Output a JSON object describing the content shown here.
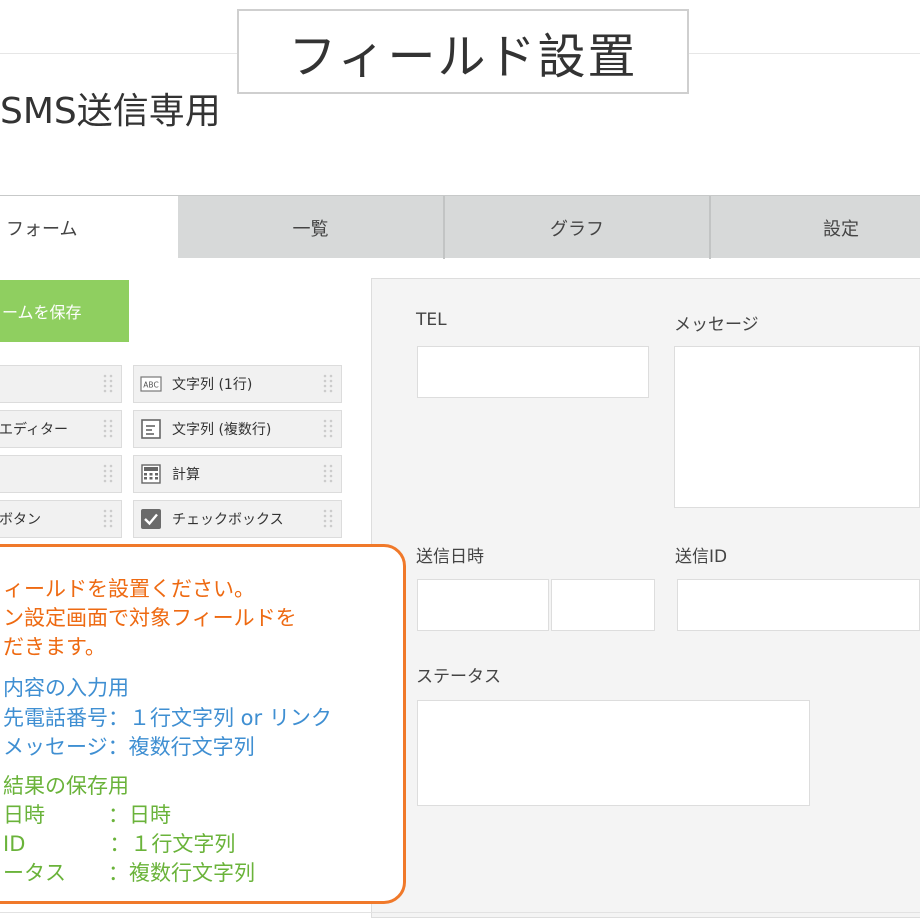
{
  "caption": "フィールド設置",
  "app_title": "SMS送信専用",
  "tabs": [
    {
      "label": "フォーム"
    },
    {
      "label": "一覧"
    },
    {
      "label": "グラフ"
    },
    {
      "label": "設定"
    }
  ],
  "save_button": "ームを保存",
  "palette": {
    "left": [
      "",
      "エディター",
      "",
      "ボタン"
    ],
    "right": [
      "文字列 (1行)",
      "文字列 (複数行)",
      "計算",
      "チェックボックス"
    ],
    "icons": [
      "abc-text-icon",
      "multiline-text-icon",
      "calculator-icon",
      "checkbox-icon"
    ],
    "abc_glyph": "ABC"
  },
  "form": {
    "tel_label": "TEL",
    "message_label": "メッセージ",
    "sent_datetime_label": "送信日時",
    "sent_id_label": "送信ID",
    "status_label": "ステータス"
  },
  "note": {
    "lines": [
      {
        "text": "ィールドを設置ください。",
        "color": "orange"
      },
      {
        "text": "ン設定画面で対象フィールドを",
        "color": "orange"
      },
      {
        "text": "だきます。",
        "color": "orange"
      },
      {
        "text": "内容の入力用",
        "color": "blue"
      },
      {
        "text": "先電話番号：１行文字列 or リンク",
        "color": "blue"
      },
      {
        "text": "メッセージ：複数行文字列",
        "color": "blue"
      },
      {
        "text": "結果の保存用",
        "color": "green"
      },
      {
        "text": "日時　　　：日時",
        "color": "green"
      },
      {
        "text": "ID　　　　：１行文字列",
        "color": "green"
      },
      {
        "text": "ータス　　：複数行文字列",
        "color": "green"
      }
    ]
  },
  "colors": {
    "save_green": "#8fcf60",
    "note_border": "#f0792a",
    "note_orange": "#ee6a12",
    "note_blue": "#3f8fd2",
    "note_green": "#6ab33a",
    "tab_bg": "#d7d9d9"
  }
}
